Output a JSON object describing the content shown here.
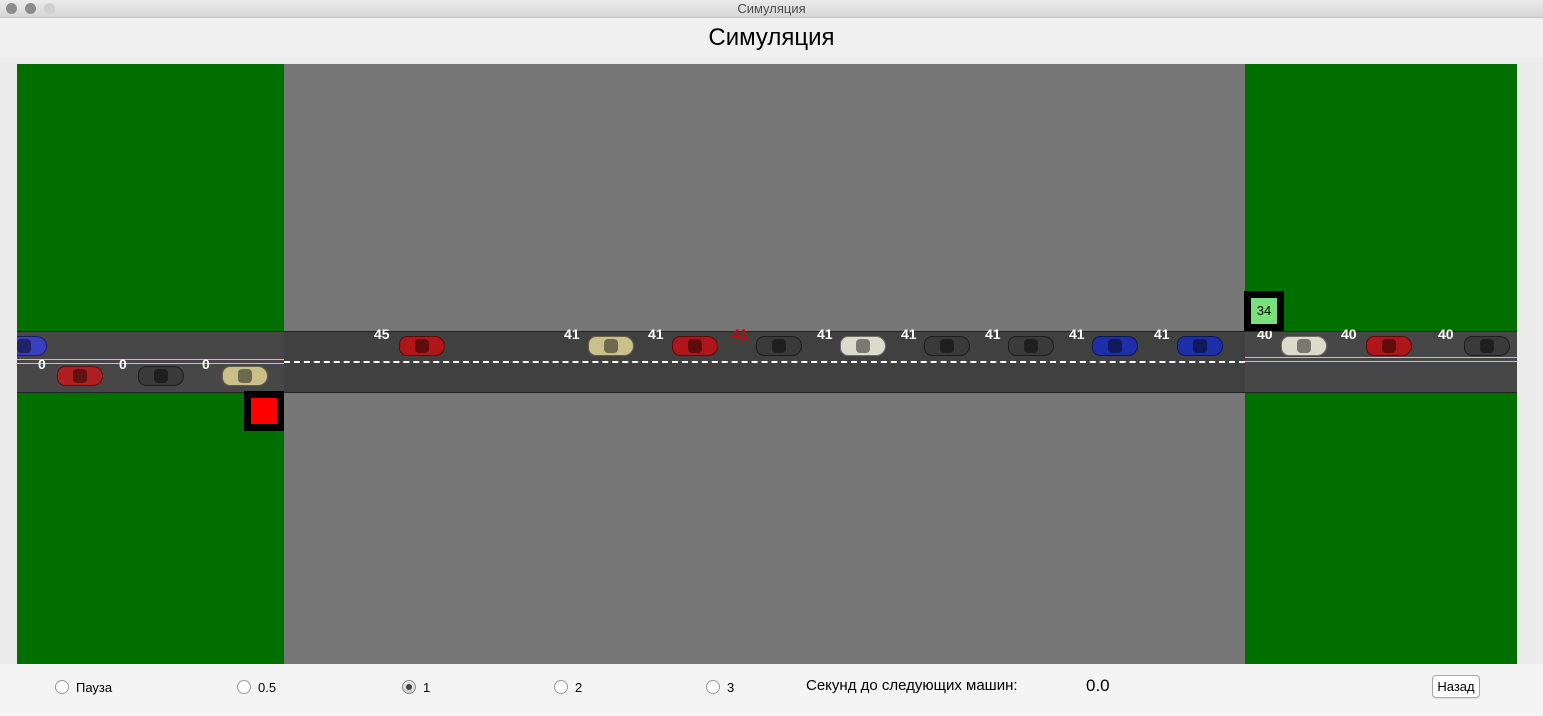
{
  "window": {
    "title": "Симуляция"
  },
  "page": {
    "title": "Симуляция"
  },
  "simulation": {
    "colors": {
      "grass": "#006f00",
      "bridge": "#777777",
      "road": "#474747",
      "lane_line": "#e6d400"
    },
    "left_signal": {
      "state": "red",
      "color": "#ff0000"
    },
    "right_signal": {
      "state": "green",
      "color": "#7ae07a",
      "value": "34"
    },
    "lower_lane_labels": [
      "0",
      "0",
      "0"
    ],
    "upper_lane_labels": [
      "45",
      "41",
      "41",
      "41",
      "41",
      "41",
      "41",
      "41",
      "41",
      "40",
      "40",
      "40"
    ],
    "highlighted_label": "41",
    "car_colors": [
      "#3a3fbf",
      "#b02020",
      "#3a3a3a",
      "#c9c08a",
      "#b0151a",
      "#c9c08a",
      "#b0151a",
      "#3a3a3a",
      "#dcdccd",
      "#3a3a3a",
      "#3a3a3a",
      "#1c2fa8",
      "#1c2fa8",
      "#dcdccd",
      "#b0151a",
      "#3a3a3a"
    ]
  },
  "controls": {
    "speed_options": [
      {
        "label": "Пауза",
        "selected": false
      },
      {
        "label": "0.5",
        "selected": false
      },
      {
        "label": "1",
        "selected": true
      },
      {
        "label": "2",
        "selected": false
      },
      {
        "label": "3",
        "selected": false
      }
    ],
    "next_cars_label": "Секунд до следующих машин:",
    "next_cars_value": "0.0",
    "back_label": "Назад"
  }
}
